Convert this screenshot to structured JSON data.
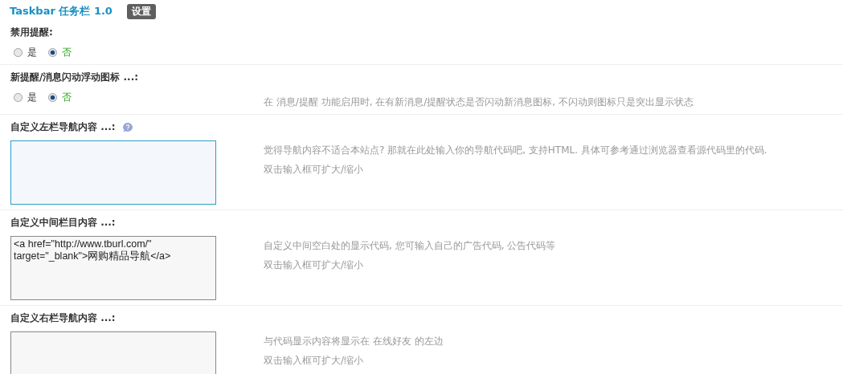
{
  "header": {
    "title": "Taskbar 任务栏 1.0",
    "settings_button": "设置"
  },
  "settings": [
    {
      "kind": "radio",
      "label": "禁用提醒:",
      "options": [
        {
          "label": "是",
          "selected": false
        },
        {
          "label": "否",
          "selected": true
        }
      ]
    },
    {
      "kind": "radio",
      "label": "新提醒/消息闪动浮动图标 ...:",
      "options": [
        {
          "label": "是",
          "selected": false
        },
        {
          "label": "否",
          "selected": true
        }
      ],
      "description": [
        "在 消息/提醒 功能启用时, 在有新消息/提醒状态是否闪动新消息图标, 不闪动则图标只是突出显示状态"
      ]
    },
    {
      "kind": "textarea",
      "label": "自定义左栏导航内容 ...:",
      "help": true,
      "focused": true,
      "description": [
        "觉得导航内容不适合本站点? 那就在此处输入你的导航代码吧, 支持HTML. 具体可参考通过浏览器查看源代码里的代码.",
        "双击输入框可扩大/缩小"
      ]
    },
    {
      "kind": "textarea",
      "label": "自定义中间栏目内容 ...:",
      "help": false,
      "focused": false,
      "value": "<a href=\"http://www.tburl.com/\" target=\"_blank\">网购精品导航</a>",
      "description": [
        "自定义中间空白处的显示代码, 您可输入自己的广告代码, 公告代码等",
        "双击输入框可扩大/缩小"
      ]
    },
    {
      "kind": "textarea",
      "label": "自定义右栏导航内容 ...:",
      "help": false,
      "focused": false,
      "description": [
        "与代码显示内容将显示在 在线好友 的左边",
        "双击输入框可扩大/缩小"
      ]
    }
  ]
}
